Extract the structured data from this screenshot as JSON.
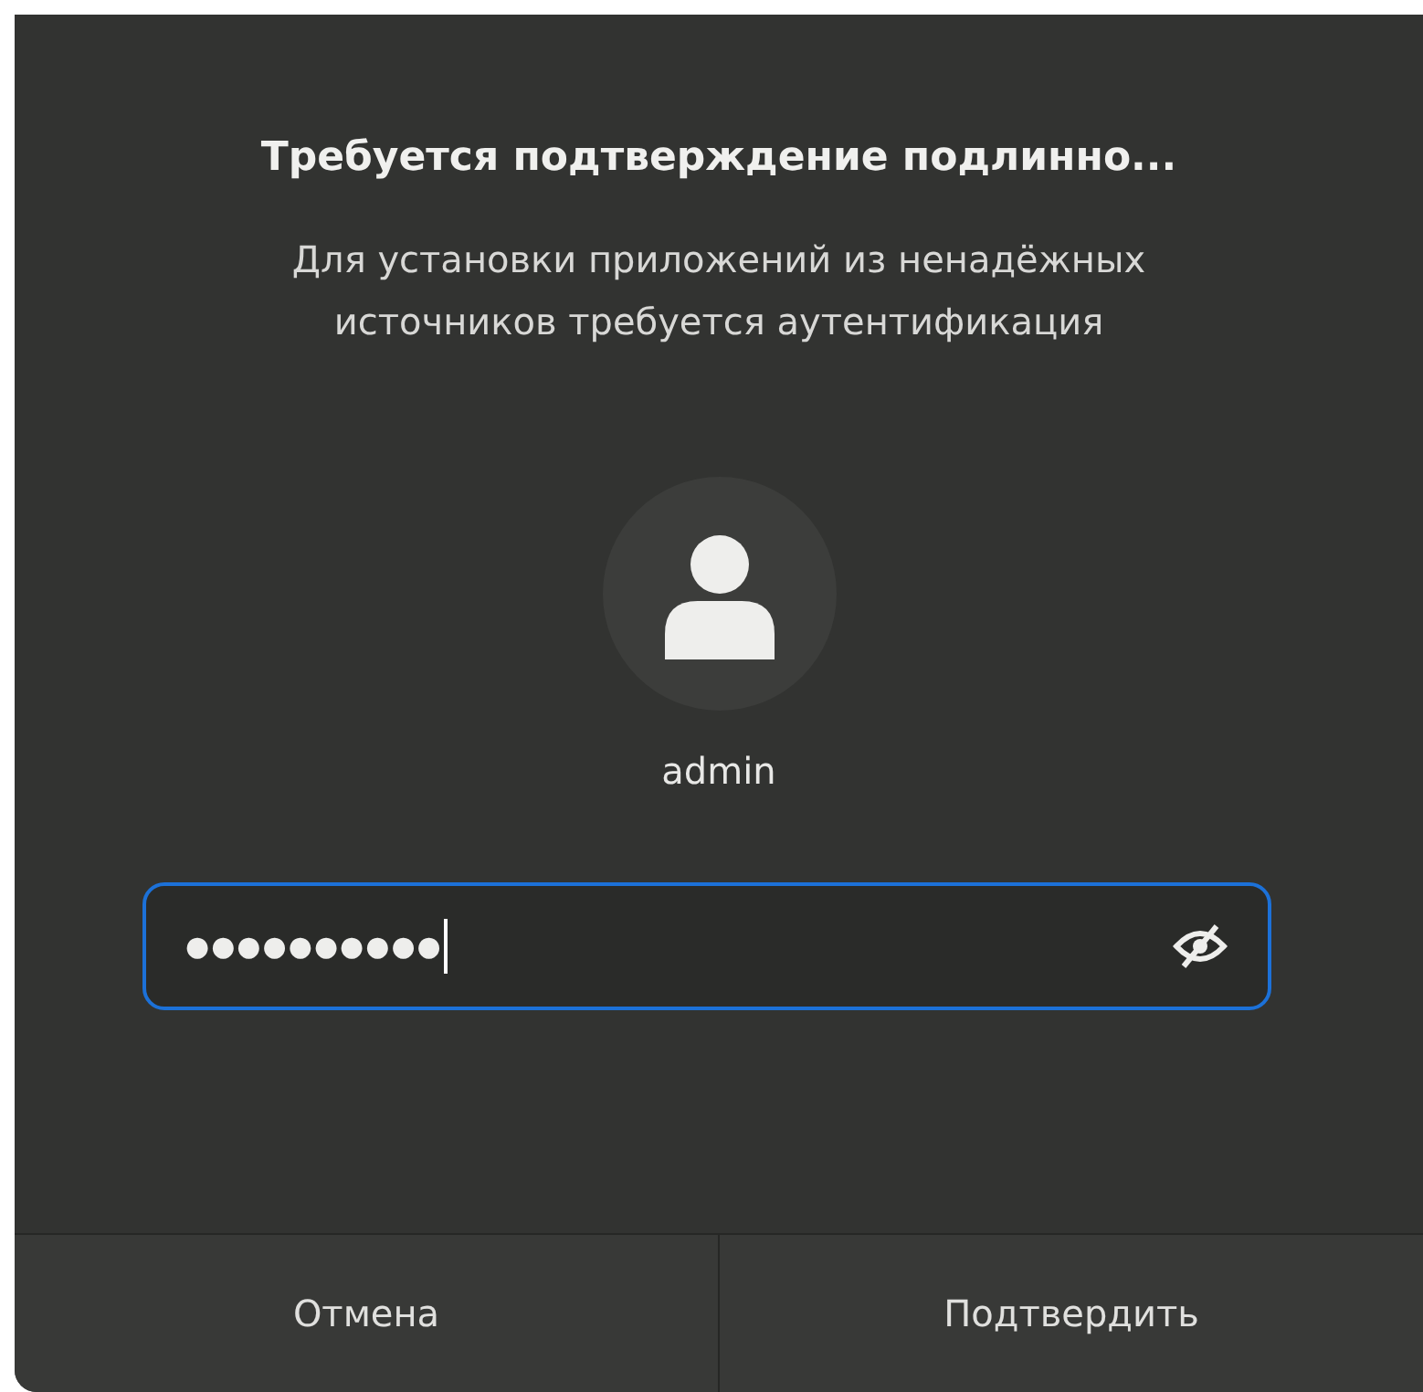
{
  "dialog": {
    "title": "Требуется подтверждение подлинно...",
    "message": "Для установки приложений из ненадёжных источников требуется аутентификация",
    "user": {
      "name": "admin"
    },
    "password_field": {
      "value": "●●●●●●●●●●",
      "focused": true
    },
    "buttons": [
      {
        "label": "Отмена"
      },
      {
        "label": "Подтвердить"
      }
    ]
  }
}
